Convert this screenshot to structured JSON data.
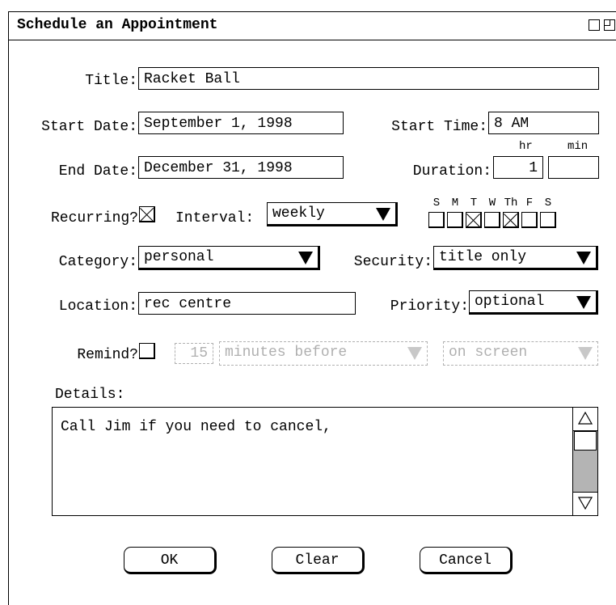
{
  "window": {
    "title": "Schedule an Appointment"
  },
  "form": {
    "title": {
      "label": "Title:",
      "value": "Racket Ball"
    },
    "start_date": {
      "label": "Start Date:",
      "value": "September 1, 1998"
    },
    "start_time": {
      "label": "Start Time:",
      "value": "8 AM"
    },
    "end_date": {
      "label": "End Date:",
      "value": "December 31, 1998"
    },
    "duration": {
      "label": "Duration:",
      "hr_label": "hr",
      "min_label": "min",
      "hr_value": "1",
      "min_value": ""
    },
    "recurring": {
      "label": "Recurring?",
      "checked": true
    },
    "interval": {
      "label": "Interval:",
      "value": "weekly"
    },
    "days": [
      {
        "label": "S",
        "checked": false
      },
      {
        "label": "M",
        "checked": false
      },
      {
        "label": "T",
        "checked": true
      },
      {
        "label": "W",
        "checked": false
      },
      {
        "label": "Th",
        "checked": true
      },
      {
        "label": "F",
        "checked": false
      },
      {
        "label": "S",
        "checked": false
      }
    ],
    "category": {
      "label": "Category:",
      "value": "personal"
    },
    "security": {
      "label": "Security:",
      "value": "title only"
    },
    "location": {
      "label": "Location:",
      "value": "rec centre"
    },
    "priority": {
      "label": "Priority:",
      "value": "optional"
    },
    "remind": {
      "label": "Remind?",
      "checked": false,
      "amount": "15",
      "units": "minutes before",
      "method": "on screen"
    },
    "details": {
      "label": "Details:",
      "value": "Call Jim if you need to cancel,"
    }
  },
  "buttons": {
    "ok": "OK",
    "clear": "Clear",
    "cancel": "Cancel"
  }
}
